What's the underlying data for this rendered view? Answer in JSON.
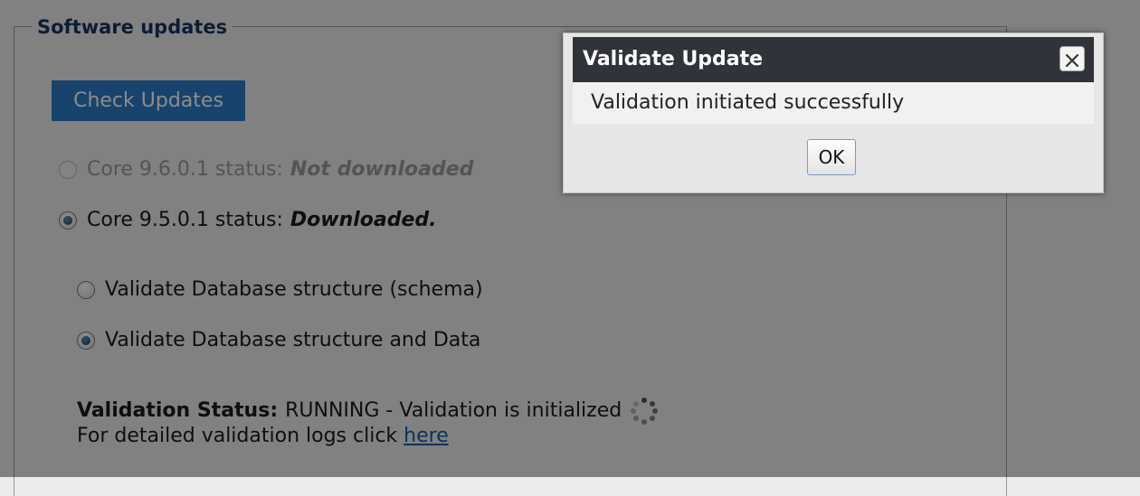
{
  "section": {
    "legend": "Software updates",
    "check_button_label": "Check Updates"
  },
  "versions": [
    {
      "label": "Core 9.6.0.1 status:",
      "status": "Not downloaded",
      "checked": false,
      "disabled": true
    },
    {
      "label": "Core 9.5.0.1 status:",
      "status": "Downloaded.",
      "checked": true,
      "disabled": false
    }
  ],
  "validate_options": [
    {
      "label": "Validate Database structure (schema)",
      "checked": false
    },
    {
      "label": "Validate Database structure and Data",
      "checked": true
    }
  ],
  "validation": {
    "status_label": "Validation Status:",
    "status_text": "RUNNING - Validation is initialized",
    "logs_prefix": "For detailed validation logs click",
    "logs_link": "here"
  },
  "dialog": {
    "title": "Validate Update",
    "message": "Validation initiated successfully",
    "ok_label": "OK"
  },
  "icons": {
    "close": "close-icon",
    "spinner": "loading-spinner-icon"
  },
  "colors": {
    "accent_button": "#2b7ac5",
    "legend_text": "#17365d",
    "dialog_titlebar": "#31333a",
    "link": "#0b5ea8"
  }
}
